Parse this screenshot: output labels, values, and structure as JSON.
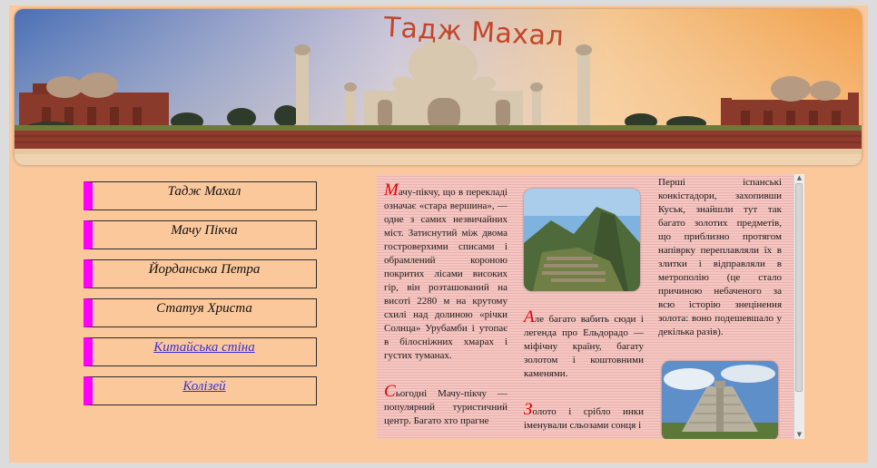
{
  "banner": {
    "title": "Тадж Махал"
  },
  "nav": {
    "items": [
      {
        "label": "Тадж Махал",
        "link": false
      },
      {
        "label": "Мачу Пікча",
        "link": false
      },
      {
        "label": "Йорданська Петра",
        "link": false
      },
      {
        "label": "Статуя Христа",
        "link": false
      },
      {
        "label": "Китайська стіна",
        "link": true
      },
      {
        "label": "Колізей",
        "link": true
      }
    ]
  },
  "article": {
    "p1": {
      "drop": "М",
      "text": "ачу-пікчу, що в перекладі означає «стара вершина», — одне з самих незвичайних міст. Затиснутий між двома гостроверхими списами і обрамлений короною покритих лісами високих гір, він розташований на висоті 2280 м на крутому схилі над долиною «річки Солнца» Урубамби і утопає в білосніжних хмарах і густих туманах."
    },
    "p2": {
      "drop": "С",
      "text": "ьогодні Мачу-пікчу — популярний туристичний центр. Багато хто прагне"
    },
    "p3": {
      "drop": "А",
      "text": "ле багато вабить сюди і легенда про Ельдорадо — міфічну країну, багату золотом і коштовними каменями."
    },
    "p4": {
      "drop": "З",
      "text": "олото і срібло инки іменували сльозами сонця і"
    },
    "p5": {
      "text": "Перші іспанські конкістадори, захопивши Куськ, знайшли тут так багато золотих предметів, що приблизно протягом напіврку переплавляли їх в злитки і відправляли в метрополію (це стало причиною небаченого за всю історію знецінення золота: воно подешевшало у декілька разів)."
    }
  },
  "colors": {
    "nav_accent": "#ff00ff",
    "dropcap": "#e00000",
    "background": "#fbc89c"
  }
}
